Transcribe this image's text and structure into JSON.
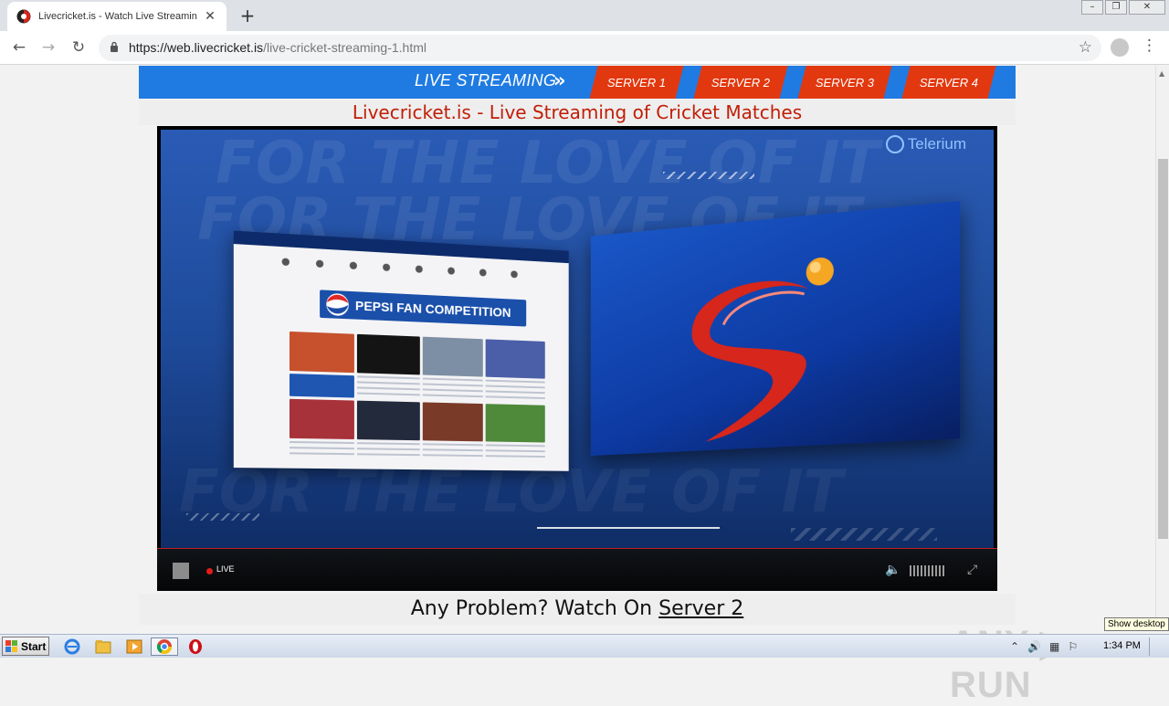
{
  "browser": {
    "tab_title": "Livecricket.is - Watch Live Streaming",
    "new_tab_label": "+",
    "url_host": "https://web.livecricket.is",
    "url_path": "/live-cricket-streaming-1.html"
  },
  "page": {
    "live_streaming_label": "LIVE STREAMING",
    "servers": [
      "SERVER 1",
      "SERVER 2",
      "SERVER 3",
      "SERVER 4"
    ],
    "title": "Livecricket.is - Live Streaming of Cricket Matches",
    "problem_text": "Any Problem? Watch On ",
    "problem_link": "Server 2",
    "colors": {
      "nav_blue": "#1f7be2",
      "server_red": "#e2380f",
      "title_red": "#c21d06"
    }
  },
  "player": {
    "brand": "Telerium",
    "live_label": "LIVE",
    "video_text": {
      "bg_phrase": "FOR THE LOVE OF IT",
      "pepsi_banner": "PEPSI FAN COMPETITION"
    }
  },
  "overlay": {
    "watermark": "ANY ▷ RUN"
  },
  "taskbar": {
    "start_label": "Start",
    "clock": "1:34 PM",
    "tooltip": "Show desktop"
  }
}
